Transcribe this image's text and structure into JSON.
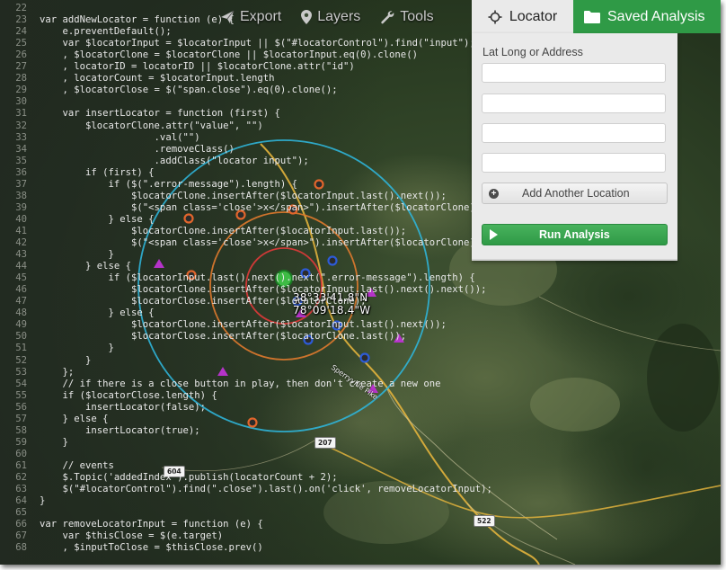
{
  "toolbar": {
    "export_label": "Export",
    "layers_label": "Layers",
    "tools_label": "Tools"
  },
  "tabs": {
    "locator_label": "Locator",
    "saved_label": "Saved Analysis"
  },
  "locator_panel": {
    "field_label": "Lat Long or Address",
    "inputs": [
      "",
      "",
      "",
      ""
    ],
    "add_button_label": "Add Another Location",
    "run_button_label": "Run Analysis"
  },
  "map": {
    "coord_lat": "38°33'41.8\"N",
    "coord_lon": "78°09'18.4\"W",
    "road_label": "Sperryville Pike",
    "shields": [
      "207",
      "604",
      "522"
    ],
    "colors": {
      "ring_inner": "#e03a3a",
      "ring_middle": "#e07a2e",
      "ring_outer": "#2fb4d8",
      "road": "#e2b33c",
      "tab_green": "#2f9a46"
    }
  },
  "code": {
    "lines": [
      {
        "n": "22",
        "text": ""
      },
      {
        "n": "23",
        "text": "var addNewLocator = function (e) {"
      },
      {
        "n": "24",
        "text": "    e.preventDefault();"
      },
      {
        "n": "25",
        "text": "    var $locatorInput = $locatorInput || $(\"#locatorControl\").find(\"input\");"
      },
      {
        "n": "26",
        "text": "    , $locatorClone = $locatorClone || $locatorInput.eq(0).clone()"
      },
      {
        "n": "27",
        "text": "    , locatorID = locatorID || $locatorClone.attr(\"id\")"
      },
      {
        "n": "28",
        "text": "    , locatorCount = $locatorInput.length"
      },
      {
        "n": "29",
        "text": "    , $locatorClose = $(\"span.close\").eq(0).clone();"
      },
      {
        "n": "30",
        "text": ""
      },
      {
        "n": "31",
        "text": "    var insertLocator = function (first) {"
      },
      {
        "n": "32",
        "text": "        $locatorClone.attr(\"value\", \"\")"
      },
      {
        "n": "33",
        "text": "                    .val(\"\")"
      },
      {
        "n": "34",
        "text": "                    .removeClass()"
      },
      {
        "n": "35",
        "text": "                    .addClass(\"locator input\");"
      },
      {
        "n": "36",
        "text": "        if (first) {"
      },
      {
        "n": "37",
        "text": "            if ($(\".error-message\").length) {"
      },
      {
        "n": "38",
        "text": "                $locatorClone.insertAfter($locatorInput.last().next());"
      },
      {
        "n": "39",
        "text": "                $(\"<span class='close'>x</span>\").insertAfter($locatorClone);"
      },
      {
        "n": "40",
        "text": "            } else {"
      },
      {
        "n": "41",
        "text": "                $locatorClone.insertAfter($locatorInput.last());"
      },
      {
        "n": "42",
        "text": "                $(\"<span class='close'>x</span>\").insertAfter($locatorClone);"
      },
      {
        "n": "43",
        "text": "            }"
      },
      {
        "n": "44",
        "text": "        } else {"
      },
      {
        "n": "45",
        "text": "            if ($locatorInput.last().next().next(\".error-message\").length) {"
      },
      {
        "n": "46",
        "text": "                $locatorClone.insertAfter($locatorInput.last().next().next());"
      },
      {
        "n": "47",
        "text": "                $locatorClose.insertAfter($locatorClone);"
      },
      {
        "n": "48",
        "text": "            } else {"
      },
      {
        "n": "49",
        "text": "                $locatorClone.insertAfter($locatorInput.last().next());"
      },
      {
        "n": "50",
        "text": "                $locatorClose.insertAfter($locatorClone.last());"
      },
      {
        "n": "51",
        "text": "            }"
      },
      {
        "n": "52",
        "text": "        }"
      },
      {
        "n": "53",
        "text": "    };"
      },
      {
        "n": "54",
        "text": "    // if there is a close button in play, then don't create a new one"
      },
      {
        "n": "55",
        "text": "    if ($locatorClose.length) {"
      },
      {
        "n": "56",
        "text": "        insertLocator(false);"
      },
      {
        "n": "57",
        "text": "    } else {"
      },
      {
        "n": "58",
        "text": "        insertLocator(true);"
      },
      {
        "n": "59",
        "text": "    }"
      },
      {
        "n": "60",
        "text": ""
      },
      {
        "n": "61",
        "text": "    // events"
      },
      {
        "n": "62",
        "text": "    $.Topic('addedIndex').publish(locatorCount + 2);"
      },
      {
        "n": "63",
        "text": "    $(\"#locatorControl\").find(\".close\").last().on('click', removeLocatorInput);"
      },
      {
        "n": "64",
        "text": "}"
      },
      {
        "n": "65",
        "text": ""
      },
      {
        "n": "66",
        "text": "var removeLocatorInput = function (e) {"
      },
      {
        "n": "67",
        "text": "    var $thisClose = $(e.target)"
      },
      {
        "n": "68",
        "text": "    , $inputToClose = $thisClose.prev()"
      }
    ]
  }
}
